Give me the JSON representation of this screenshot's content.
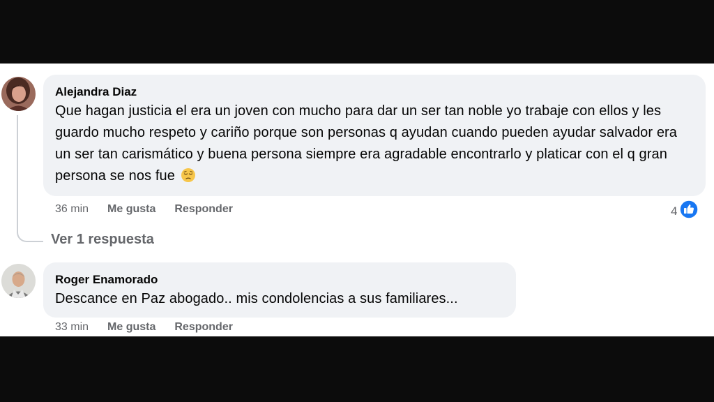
{
  "comments": [
    {
      "author": "Alejandra Diaz",
      "text": "Que hagan justicia el era un joven con mucho para dar un ser tan noble yo trabaje con ellos y les guardo mucho respeto y cariño porque son personas q ayudan cuando pueden ayudar salvador era un ser tan carismático y buena persona siempre era agradable encontrarlo y platicar con el q gran persona se nos fue",
      "emoji": "pensive-face-icon",
      "time": "36 min",
      "like_label": "Me gusta",
      "reply_label": "Responder",
      "reaction_count": "4",
      "reaction_icon": "like-thumb-icon",
      "view_replies": "Ver 1 respuesta"
    },
    {
      "author": "Roger Enamorado",
      "text": "Descance en Paz abogado.. mis condolencias a sus familiares...",
      "time": "33 min",
      "like_label": "Me gusta",
      "reply_label": "Responder"
    }
  ],
  "colors": {
    "bubble": "#f0f2f5",
    "secondary_text": "#65676b",
    "like_blue": "#1877f2",
    "letterbox": "#0c0c0c"
  }
}
